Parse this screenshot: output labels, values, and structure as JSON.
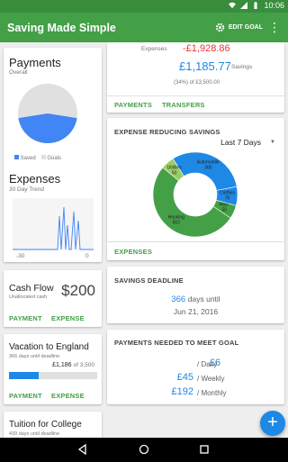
{
  "status": {
    "time": "10:06"
  },
  "appbar": {
    "title": "Saving Made Simple",
    "edit_goal": "EDIT GOAL"
  },
  "payments": {
    "title": "Payments",
    "subtitle": "Overall",
    "legend": [
      "Saved",
      "Goals"
    ],
    "saved_fraction": 0.45,
    "colors": {
      "saved": "#4285f4",
      "goals": "#e0e0e0"
    }
  },
  "expenses_card": {
    "title": "Expenses",
    "subtitle": "30 Day Trend",
    "axis_left": "-30",
    "axis_right": "0"
  },
  "cashflow": {
    "title": "Cash Flow",
    "subtitle": "Unallocated cash",
    "amount": "$200",
    "payment": "PAYMENT",
    "expense": "EXPENSE"
  },
  "vacation": {
    "title": "Vacation to England",
    "subtitle": "366 days until deadline",
    "saved_label": "£1,186",
    "of_label": "of 3,500",
    "progress": 0.34,
    "payment": "PAYMENT",
    "expense": "EXPENSE"
  },
  "college": {
    "title": "Tuition for College",
    "subtitle": "439 days until deadline"
  },
  "summary": {
    "expenses_label": "Expenses",
    "expenses_value": "-£1,928.86",
    "savings_value": "£1,185.77",
    "savings_label": "Savings",
    "percent_text": "(34%) of £3,500.00",
    "payments_action": "PAYMENTS",
    "transfers_action": "TRANSFERS"
  },
  "reducing": {
    "title": "EXPENSE REDUCING SAVINGS",
    "range": "Last 7 Days",
    "action": "EXPENSES",
    "segments": [
      {
        "name": "Housing",
        "value": 502,
        "label": "Housing\n502",
        "color": "#43a047"
      },
      {
        "name": "Utilities",
        "value": 50,
        "label": "Utilities\n50",
        "color": "#9ccc65"
      },
      {
        "name": "Automobile",
        "value": 300,
        "label": "Automobile\n300",
        "color": "#1e88e5"
      },
      {
        "name": "Clothes",
        "value": 70,
        "label": "Clothes\n70",
        "color": "#1e88e5"
      },
      {
        "name": "Misc",
        "value": 50,
        "label": "Misc.\n50",
        "color": "#43a047"
      }
    ]
  },
  "deadline": {
    "title": "SAVINGS DEADLINE",
    "days": "366",
    "days_until": "days until",
    "date": "Jun 21, 2016"
  },
  "needed": {
    "title": "PAYMENTS NEEDED TO MEET GOAL",
    "rows": [
      {
        "amount": "£6",
        "period": "/ Daily"
      },
      {
        "amount": "£45",
        "period": "/ Weekly"
      },
      {
        "amount": "£192",
        "period": "/ Monthly"
      }
    ]
  }
}
